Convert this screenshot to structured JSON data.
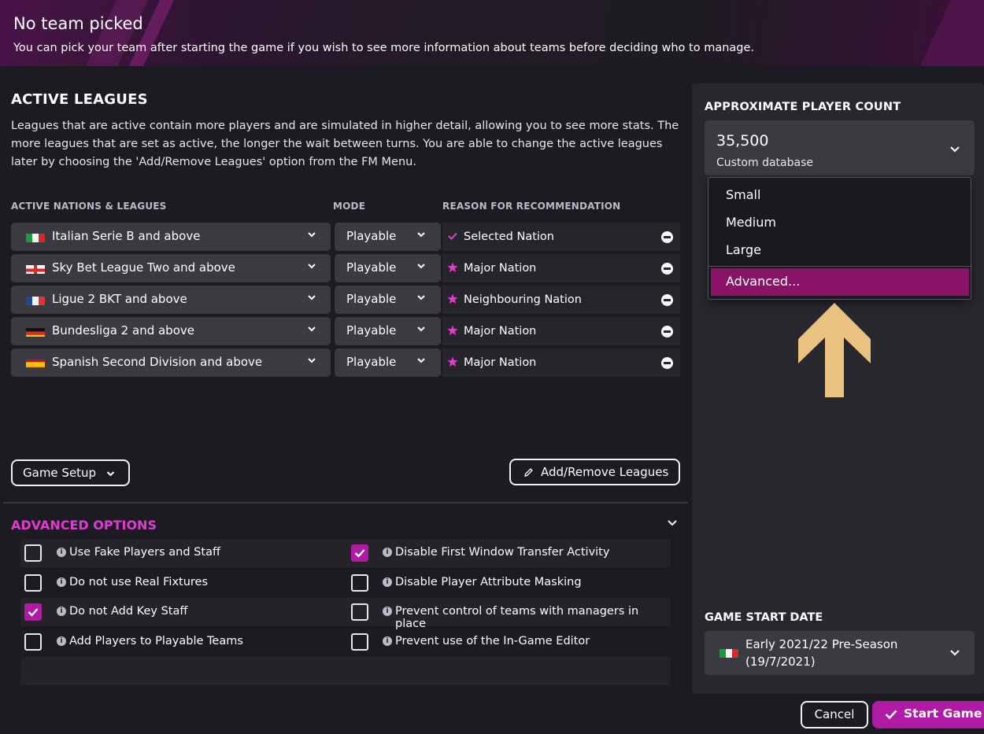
{
  "header": {
    "title": "No team picked",
    "subtitle": "You can pick your team after starting the game if you wish to see more information about teams before deciding who to manage."
  },
  "active_leagues": {
    "title": "ACTIVE LEAGUES",
    "description": "Leagues that are active contain more players and are simulated in higher detail, allowing you to see more stats. The more leagues that are set as active, the longer the wait between turns. You are able to change the active leagues later by choosing the 'Add/Remove Leagues' option from the FM Menu.",
    "columns": {
      "nations": "ACTIVE NATIONS & LEAGUES",
      "mode": "MODE",
      "reason": "REASON FOR RECOMMENDATION"
    },
    "rows": [
      {
        "flag": "italy-flag",
        "league": "Italian Serie B and above",
        "mode": "Playable",
        "reason_icon": "check-icon",
        "reason": "Selected Nation"
      },
      {
        "flag": "england-flag",
        "league": "Sky Bet League Two and above",
        "mode": "Playable",
        "reason_icon": "star-icon",
        "reason": "Major Nation"
      },
      {
        "flag": "france-flag",
        "league": "Ligue 2 BKT and above",
        "mode": "Playable",
        "reason_icon": "star-icon",
        "reason": "Neighbouring Nation"
      },
      {
        "flag": "germany-flag",
        "league": "Bundesliga 2 and above",
        "mode": "Playable",
        "reason_icon": "star-icon",
        "reason": "Major Nation"
      },
      {
        "flag": "spain-flag",
        "league": "Spanish Second Division and above",
        "mode": "Playable",
        "reason_icon": "star-icon",
        "reason": "Major Nation"
      }
    ],
    "game_setup_label": "Game Setup",
    "add_remove_label": "Add/Remove Leagues"
  },
  "advanced_options": {
    "title": "ADVANCED OPTIONS",
    "left": [
      {
        "label": "Use Fake Players and Staff",
        "checked": false
      },
      {
        "label": "Do not use Real Fixtures",
        "checked": false
      },
      {
        "label": "Do not Add Key Staff",
        "checked": true
      },
      {
        "label": "Add Players to Playable Teams",
        "checked": false
      }
    ],
    "right": [
      {
        "label": "Disable First Window Transfer Activity",
        "checked": true
      },
      {
        "label": "Disable Player Attribute Masking",
        "checked": false
      },
      {
        "label": "Prevent control of teams with managers in place",
        "checked": false
      },
      {
        "label": "Prevent use of the In-Game Editor",
        "checked": false
      }
    ]
  },
  "player_count": {
    "title": "APPROXIMATE PLAYER COUNT",
    "value": "35,500",
    "subtitle": "Custom database",
    "menu_options": [
      "Small",
      "Medium",
      "Large",
      "Advanced..."
    ],
    "highlighted_option": "Advanced..."
  },
  "game_start": {
    "title": "GAME START DATE",
    "flag": "italy-flag",
    "line1": "Early 2021/22 Pre-Season",
    "line2": "(19/7/2021)"
  },
  "footer": {
    "cancel_label": "Cancel",
    "start_label": "Start Game"
  },
  "colors": {
    "accent": "#b01aa5",
    "highlight": "#8a1369",
    "advanced_title": "#e23ad3",
    "arrow": "#e8c27e",
    "background": "#1c1b21",
    "panel": "#28272e"
  }
}
